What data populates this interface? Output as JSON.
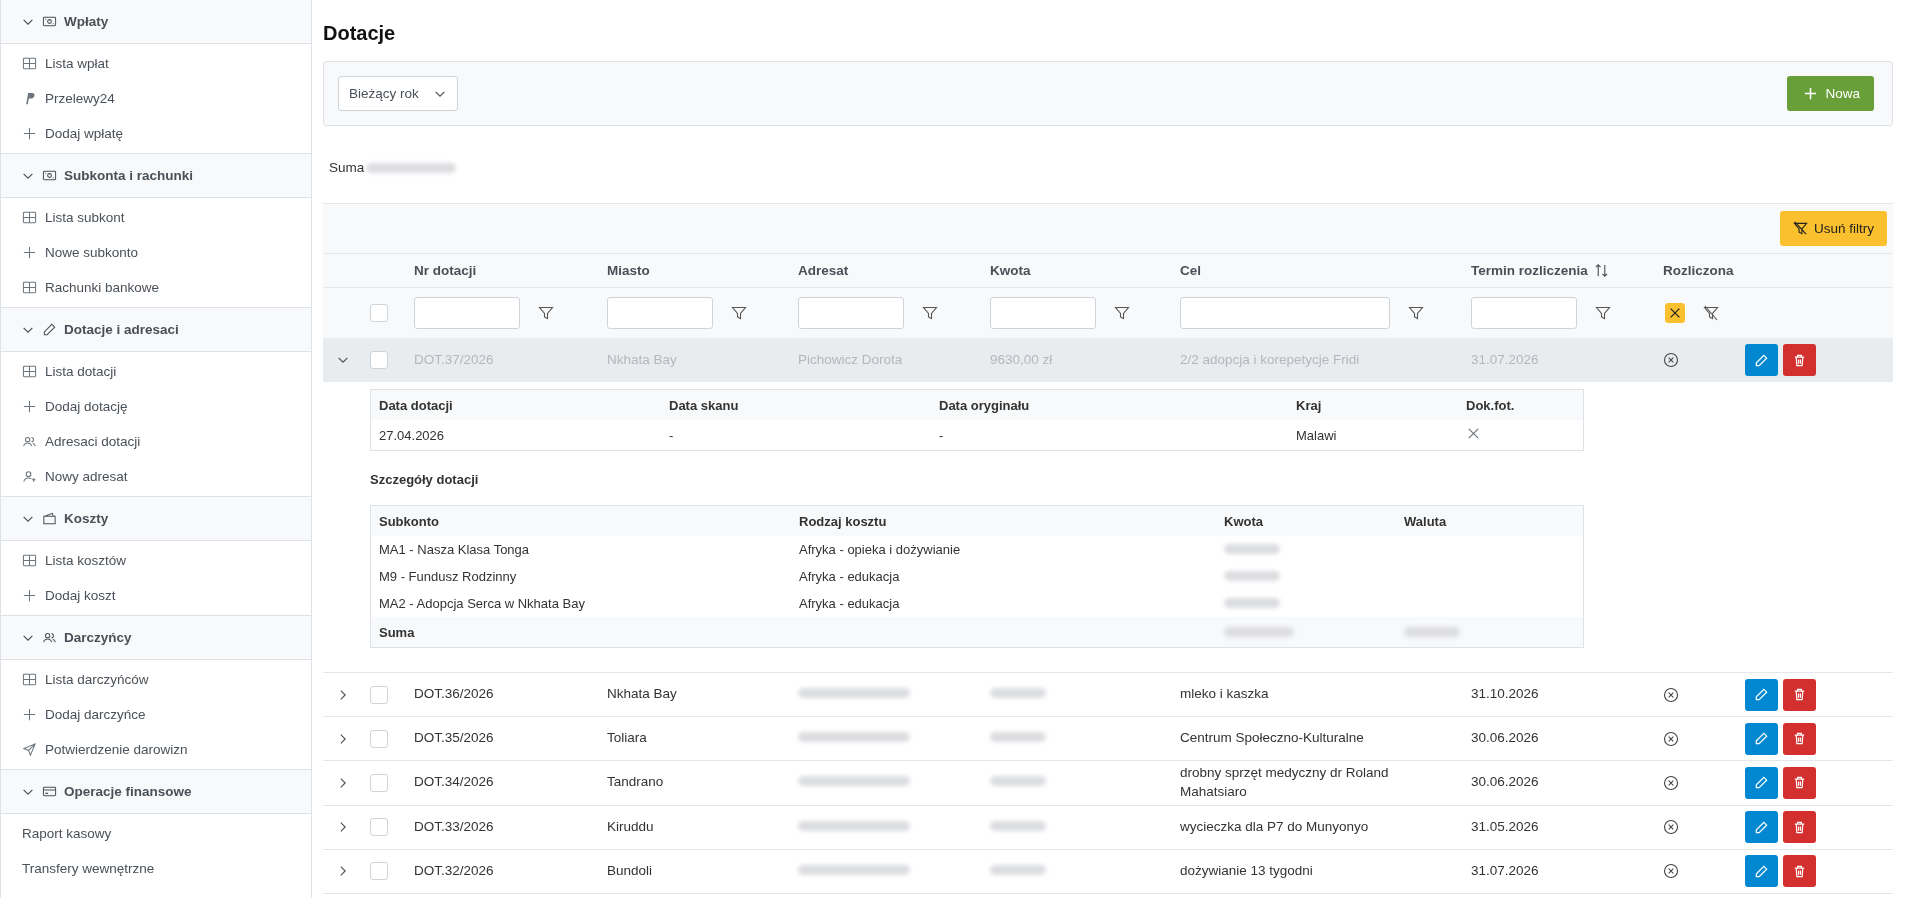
{
  "sidebar": {
    "sections": [
      {
        "title": "Wpłaty",
        "expanded": true,
        "items": [
          {
            "label": "Lista wpłat"
          },
          {
            "label": "Przelewy24"
          },
          {
            "label": "Dodaj wpłatę"
          }
        ]
      },
      {
        "title": "Subkonta i rachunki",
        "expanded": true,
        "items": [
          {
            "label": "Lista subkont"
          },
          {
            "label": "Nowe subkonto"
          },
          {
            "label": "Rachunki bankowe"
          }
        ]
      },
      {
        "title": "Dotacje i adresaci",
        "expanded": true,
        "items": [
          {
            "label": "Lista dotacji"
          },
          {
            "label": "Dodaj dotację"
          },
          {
            "label": "Adresaci dotacji"
          },
          {
            "label": "Nowy adresat"
          }
        ]
      },
      {
        "title": "Koszty",
        "expanded": true,
        "items": [
          {
            "label": "Lista kosztów"
          },
          {
            "label": "Dodaj koszt"
          }
        ]
      },
      {
        "title": "Darczyńcy",
        "expanded": true,
        "items": [
          {
            "label": "Lista darczyńców"
          },
          {
            "label": "Dodaj darczyńce"
          },
          {
            "label": "Potwierdzenie darowizn"
          }
        ]
      },
      {
        "title": "Operacje finansowe",
        "expanded": true,
        "items": [
          {
            "label": "Raport kasowy"
          },
          {
            "label": "Transfery wewnętrzne"
          }
        ]
      }
    ]
  },
  "page_title": "Dotacje",
  "toolbar": {
    "period": "Bieżący rok",
    "new_button": "Nowa"
  },
  "sum_label": "Suma",
  "clear_filters_button": "Usuń filtry",
  "table": {
    "columns": [
      {
        "label": "Nr dotacji",
        "kind": "text"
      },
      {
        "label": "Miasto",
        "kind": "text"
      },
      {
        "label": "Adresat",
        "kind": "text"
      },
      {
        "label": "Kwota",
        "kind": "text"
      },
      {
        "label": "Cel",
        "kind": "text"
      },
      {
        "label": "Termin rozliczenia",
        "kind": "text",
        "sortable": true
      },
      {
        "label": "Rozliczona",
        "kind": "tristate",
        "filter_value": false
      }
    ],
    "all_selected": false,
    "rows": [
      {
        "nr": "DOT.37/2026",
        "miasto": "Nkhata Bay",
        "adresat": "Pichowicz Dorota",
        "kwota": "9630,00 zł",
        "cel": "2/2 adopcja i korepetycje Fridi",
        "termin": "31.07.2026",
        "dimmed": true,
        "expanded": true,
        "selected": false,
        "settled": false,
        "details": {
          "info_columns": [
            "Data dotacji",
            "Data skanu",
            "Data oryginału",
            "Kraj",
            "Dok.fot."
          ],
          "info_row": {
            "data_dotacji": "27.04.2026",
            "data_skanu": "-",
            "data_oryginalu": "-",
            "kraj": "Malawi",
            "dok_fot": false
          },
          "title": "Szczegóły dotacji",
          "columns": [
            "Subkonto",
            "Rodzaj kosztu",
            "Kwota",
            "Waluta"
          ],
          "rows": [
            {
              "subkonto": "MA1 - Nasza Klasa Tonga",
              "rodzaj": "Afryka - opieka i dożywianie"
            },
            {
              "subkonto": "M9 - Fundusz Rodzinny",
              "rodzaj": "Afryka - edukacja"
            },
            {
              "subkonto": "MA2 - Adopcja Serca w Nkhata Bay",
              "rodzaj": "Afryka - edukacja"
            }
          ],
          "total_label": "Suma"
        }
      },
      {
        "nr": "DOT.36/2026",
        "miasto": "Nkhata Bay",
        "cel": "mleko i kaszka",
        "termin": "31.10.2026",
        "dimmed": false,
        "expanded": false,
        "selected": false,
        "settled": false
      },
      {
        "nr": "DOT.35/2026",
        "miasto": "Toliara",
        "cel": "Centrum Społeczno-Kulturalne",
        "termin": "30.06.2026",
        "dimmed": false,
        "expanded": false,
        "selected": false,
        "settled": false
      },
      {
        "nr": "DOT.34/2026",
        "miasto": "Tandrano",
        "cel": "drobny sprzęt medyczny dr Roland Mahatsiaro",
        "termin": "30.06.2026",
        "dimmed": false,
        "expanded": false,
        "selected": false,
        "settled": false
      },
      {
        "nr": "DOT.33/2026",
        "miasto": "Kiruddu",
        "cel": "wycieczka dla P7 do Munyonyo",
        "termin": "31.05.2026",
        "dimmed": false,
        "expanded": false,
        "selected": false,
        "settled": false
      },
      {
        "nr": "DOT.32/2026",
        "miasto": "Bundoli",
        "cel": "dożywianie 13 tygodni",
        "termin": "31.07.2026",
        "dimmed": false,
        "expanded": false,
        "selected": false,
        "settled": false
      }
    ]
  }
}
